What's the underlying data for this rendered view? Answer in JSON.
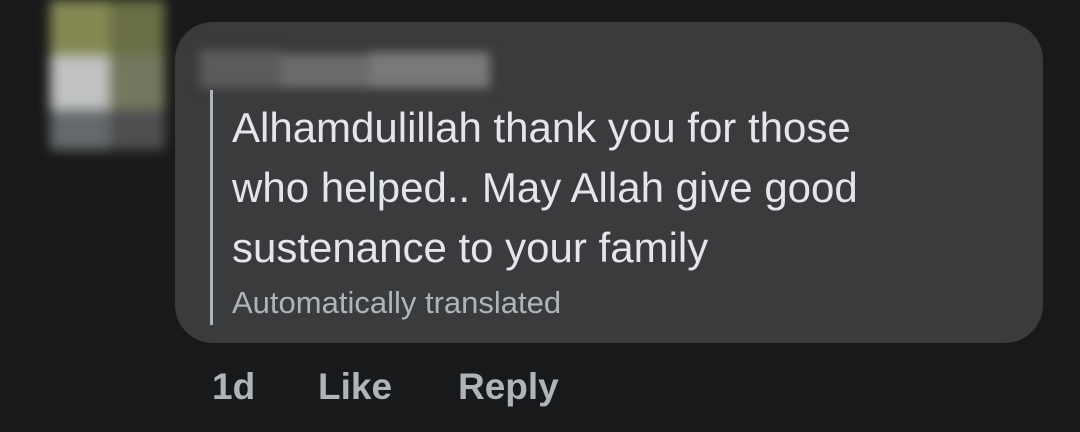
{
  "comment": {
    "author_name": "",
    "text": "Alhamdulillah thank you for those\nwho helped.. May Allah give good\nsustenance to your family",
    "translation_note": "Automatically translated"
  },
  "actions": {
    "timestamp": "1d",
    "like_label": "Like",
    "reply_label": "Reply"
  },
  "colors": {
    "background": "#18191a",
    "bubble": "#3a3b3c",
    "primary_text": "#e4e6eb",
    "secondary_text": "#b0b3b8"
  }
}
